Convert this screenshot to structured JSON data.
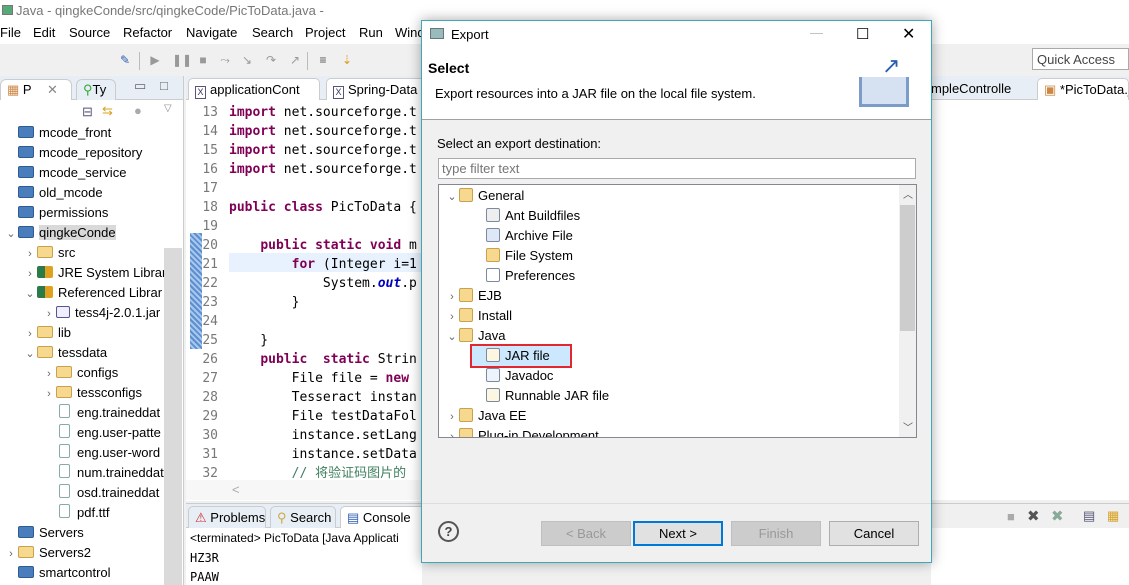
{
  "window": {
    "title": "Java - qingkeConde/src/qingkeCode/PicToData.java -"
  },
  "menu": [
    "File",
    "Edit",
    "Source",
    "Refactor",
    "Navigate",
    "Search",
    "Project",
    "Run",
    "Wind"
  ],
  "quick_access": "Quick Access",
  "left_panel": {
    "tabs": [
      "P",
      "Ty"
    ],
    "tree": [
      {
        "label": "mcode_front",
        "depth": 0,
        "icon": "project",
        "chev": ""
      },
      {
        "label": "mcode_repository",
        "depth": 0,
        "icon": "project",
        "chev": ""
      },
      {
        "label": "mcode_service",
        "depth": 0,
        "icon": "project",
        "chev": ""
      },
      {
        "label": "old_mcode",
        "depth": 0,
        "icon": "project",
        "chev": ""
      },
      {
        "label": "permissions",
        "depth": 0,
        "icon": "project",
        "chev": ""
      },
      {
        "label": "qingkeConde",
        "depth": 0,
        "icon": "java-project",
        "chev": "down",
        "selected": true
      },
      {
        "label": "src",
        "depth": 1,
        "icon": "package",
        "chev": "right"
      },
      {
        "label": "JRE System Librar",
        "depth": 1,
        "icon": "library",
        "chev": "right"
      },
      {
        "label": "Referenced Librar",
        "depth": 1,
        "icon": "library",
        "chev": "down"
      },
      {
        "label": "tess4j-2.0.1.jar",
        "depth": 2,
        "icon": "jar",
        "chev": "right"
      },
      {
        "label": "lib",
        "depth": 1,
        "icon": "folder",
        "chev": "right"
      },
      {
        "label": "tessdata",
        "depth": 1,
        "icon": "folder",
        "chev": "down"
      },
      {
        "label": "configs",
        "depth": 2,
        "icon": "folder",
        "chev": "right"
      },
      {
        "label": "tessconfigs",
        "depth": 2,
        "icon": "folder",
        "chev": "right"
      },
      {
        "label": "eng.traineddat",
        "depth": 2,
        "icon": "file",
        "chev": ""
      },
      {
        "label": "eng.user-patte",
        "depth": 2,
        "icon": "file",
        "chev": ""
      },
      {
        "label": "eng.user-word",
        "depth": 2,
        "icon": "file",
        "chev": ""
      },
      {
        "label": "num.traineddat",
        "depth": 2,
        "icon": "file",
        "chev": ""
      },
      {
        "label": "osd.traineddat",
        "depth": 2,
        "icon": "file",
        "chev": ""
      },
      {
        "label": "pdf.ttf",
        "depth": 2,
        "icon": "file",
        "chev": ""
      },
      {
        "label": "Servers",
        "depth": 0,
        "icon": "project",
        "chev": ""
      },
      {
        "label": "Servers2",
        "depth": 0,
        "icon": "folder",
        "chev": "right"
      },
      {
        "label": "smartcontrol",
        "depth": 0,
        "icon": "project",
        "chev": ""
      }
    ]
  },
  "editor": {
    "tabs": [
      "applicationCont",
      "Spring-Data",
      "mpleControlle",
      "*PicToData.j"
    ],
    "lines": [
      {
        "n": "13",
        "seg": [
          [
            "import",
            "kw"
          ],
          [
            " net.sourceforge.t",
            ""
          ]
        ]
      },
      {
        "n": "14",
        "seg": [
          [
            "import",
            "kw"
          ],
          [
            " net.sourceforge.t",
            ""
          ]
        ]
      },
      {
        "n": "15",
        "seg": [
          [
            "import",
            "kw"
          ],
          [
            " net.sourceforge.t",
            ""
          ]
        ]
      },
      {
        "n": "16",
        "seg": [
          [
            "import",
            "kw"
          ],
          [
            " net.sourceforge.t",
            ""
          ]
        ]
      },
      {
        "n": "17",
        "seg": []
      },
      {
        "n": "18",
        "seg": [
          [
            "public class",
            "kw"
          ],
          [
            " PicToData {",
            ""
          ]
        ]
      },
      {
        "n": "19",
        "seg": []
      },
      {
        "n": "20",
        "seg": [
          [
            "    ",
            ""
          ],
          [
            "public static void",
            "kw"
          ],
          [
            " m",
            ""
          ]
        ]
      },
      {
        "n": "21",
        "seg": [
          [
            "        ",
            ""
          ],
          [
            "for",
            "kw"
          ],
          [
            " (Integer i=1",
            ""
          ]
        ]
      },
      {
        "n": "22",
        "seg": [
          [
            "            System.",
            ""
          ],
          [
            "out",
            "fld"
          ],
          [
            ".p",
            ""
          ]
        ]
      },
      {
        "n": "23",
        "seg": [
          [
            "        }",
            ""
          ]
        ]
      },
      {
        "n": "24",
        "seg": []
      },
      {
        "n": "25",
        "seg": [
          [
            "    }",
            ""
          ]
        ]
      },
      {
        "n": "26",
        "seg": [
          [
            "    ",
            ""
          ],
          [
            "public  static",
            "kw"
          ],
          [
            " Strin",
            ""
          ]
        ]
      },
      {
        "n": "27",
        "seg": [
          [
            "        File file = ",
            ""
          ],
          [
            "new",
            "kw"
          ]
        ]
      },
      {
        "n": "28",
        "seg": [
          [
            "        Tesseract instan",
            ""
          ]
        ]
      },
      {
        "n": "29",
        "seg": [
          [
            "        File testDataFol",
            ""
          ]
        ]
      },
      {
        "n": "30",
        "seg": [
          [
            "        instance.setLang",
            ""
          ]
        ]
      },
      {
        "n": "31",
        "seg": [
          [
            "        instance.setData",
            ""
          ]
        ]
      },
      {
        "n": "32",
        "seg": [
          [
            "        // 将验证码图片的",
            "cmt"
          ]
        ]
      }
    ]
  },
  "console": {
    "tabs": [
      "Problems",
      "Search",
      "Console"
    ],
    "status": "<terminated> PicToData [Java Applicati",
    "output": [
      "HZ3R",
      "PAAW"
    ]
  },
  "dialog": {
    "title": "Export",
    "heading": "Select",
    "description": "Export resources into a JAR file on the local file system.",
    "prompt": "Select an export destination:",
    "filter_placeholder": "type filter text",
    "tree": [
      {
        "label": "General",
        "depth": 0,
        "chev": "down",
        "icon": "folder"
      },
      {
        "label": "Ant Buildfiles",
        "depth": 1,
        "icon": "ant"
      },
      {
        "label": "Archive File",
        "depth": 1,
        "icon": "archive"
      },
      {
        "label": "File System",
        "depth": 1,
        "icon": "folder"
      },
      {
        "label": "Preferences",
        "depth": 1,
        "icon": "preferences"
      },
      {
        "label": "EJB",
        "depth": 0,
        "chev": "right",
        "icon": "folder"
      },
      {
        "label": "Install",
        "depth": 0,
        "chev": "right",
        "icon": "folder"
      },
      {
        "label": "Java",
        "depth": 0,
        "chev": "down",
        "icon": "folder"
      },
      {
        "label": "JAR file",
        "depth": 1,
        "icon": "jar",
        "selected": true
      },
      {
        "label": "Javadoc",
        "depth": 1,
        "icon": "javadoc"
      },
      {
        "label": "Runnable JAR file",
        "depth": 1,
        "icon": "runnable-jar"
      },
      {
        "label": "Java EE",
        "depth": 0,
        "chev": "right",
        "icon": "folder"
      },
      {
        "label": "Plug-in Development",
        "depth": 0,
        "chev": "right",
        "icon": "folder"
      }
    ],
    "buttons": {
      "back": "< Back",
      "next": "Next >",
      "finish": "Finish",
      "cancel": "Cancel"
    },
    "highlight_color": "#e0282e"
  }
}
